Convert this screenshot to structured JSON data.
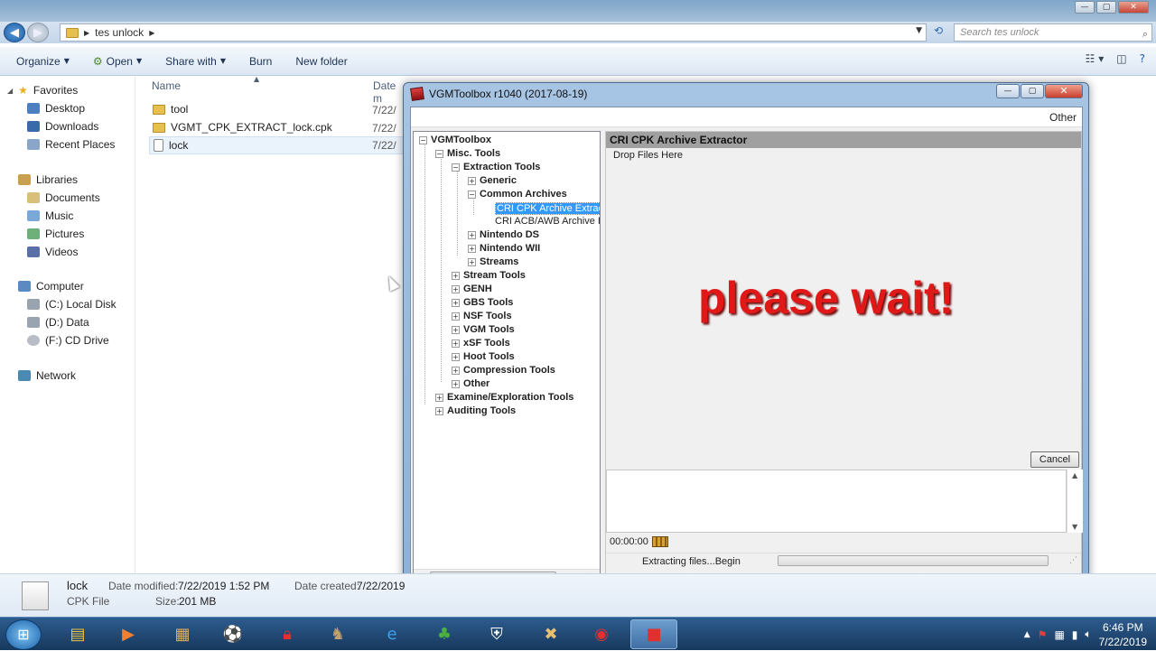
{
  "explorer": {
    "breadcrumb": "tes unlock",
    "search_placeholder": "Search tes unlock",
    "toolbar": {
      "organize": "Organize",
      "open": "Open",
      "share_with": "Share with",
      "burn": "Burn",
      "new_folder": "New folder"
    },
    "nav": {
      "favorites": "Favorites",
      "desktop": "Desktop",
      "downloads": "Downloads",
      "recent": "Recent Places",
      "libraries": "Libraries",
      "documents": "Documents",
      "music": "Music",
      "pictures": "Pictures",
      "videos": "Videos",
      "computer": "Computer",
      "c_drive": "(C:) Local Disk",
      "d_drive": "(D:) Data",
      "f_drive": "(F:) CD Drive",
      "network": "Network"
    },
    "columns": {
      "name": "Name",
      "date": "Date m"
    },
    "files": [
      {
        "name": "tool",
        "date": "7/22/"
      },
      {
        "name": "VGMT_CPK_EXTRACT_lock.cpk",
        "date": "7/22/"
      },
      {
        "name": "lock",
        "date": "7/22/"
      }
    ],
    "details": {
      "name": "lock",
      "type": "CPK File",
      "modified_label": "Date modified:",
      "modified": "7/22/2019 1:52 PM",
      "size_label": "Size:",
      "size": "201 MB",
      "created_label": "Date created:",
      "created": "7/22/2019"
    }
  },
  "vgm": {
    "title": "VGMToolbox r1040 (2017-08-19)",
    "menu_other": "Other",
    "tree": {
      "root": "VGMToolbox",
      "misc": "Misc. Tools",
      "extraction": "Extraction Tools",
      "generic": "Generic",
      "common": "Common Archives",
      "cri_cpk": "CRI CPK Archive Extract",
      "cri_acb": "CRI ACB/AWB Archive I",
      "nds": "Nintendo DS",
      "wii": "Nintendo WII",
      "streams": "Streams",
      "stream_tools": "Stream Tools",
      "genh": "GENH",
      "gbs": "GBS Tools",
      "nsf": "NSF Tools",
      "vgm_tools": "VGM Tools",
      "xsf": "xSF Tools",
      "hoot": "Hoot Tools",
      "compression": "Compression Tools",
      "other": "Other",
      "examine": "Examine/Exploration Tools",
      "auditing": "Auditing Tools"
    },
    "panel_title": "CRI CPK Archive Extractor",
    "drop_hint": "Drop Files Here",
    "overlay": "please wait!",
    "cancel": "Cancel",
    "elapsed": "00:00:00",
    "status": "Extracting files...Begin"
  },
  "taskbar": {
    "time": "6:46 PM",
    "date": "7/22/2019"
  }
}
